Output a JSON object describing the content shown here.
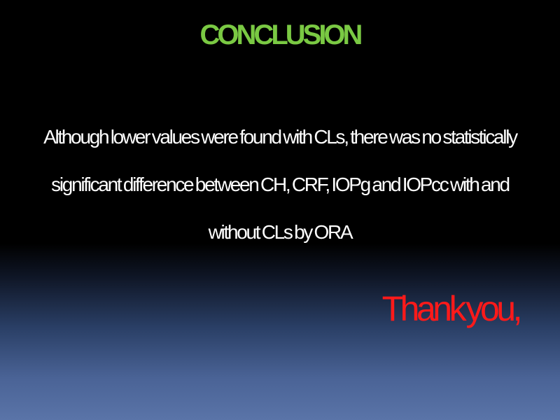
{
  "slide": {
    "title": "CONCLUSION",
    "body": "Although lower values were found with CLs, there was no statistically significant difference between CH, CRF, IOPg and IOPcc with and without CLs by ORA",
    "closing": "Thank you,"
  },
  "colors": {
    "title": "#7ac943",
    "body": "#ffffff",
    "closing": "#ff1a1a",
    "background_top": "#000000",
    "background_bottom": "#5a74a8"
  }
}
